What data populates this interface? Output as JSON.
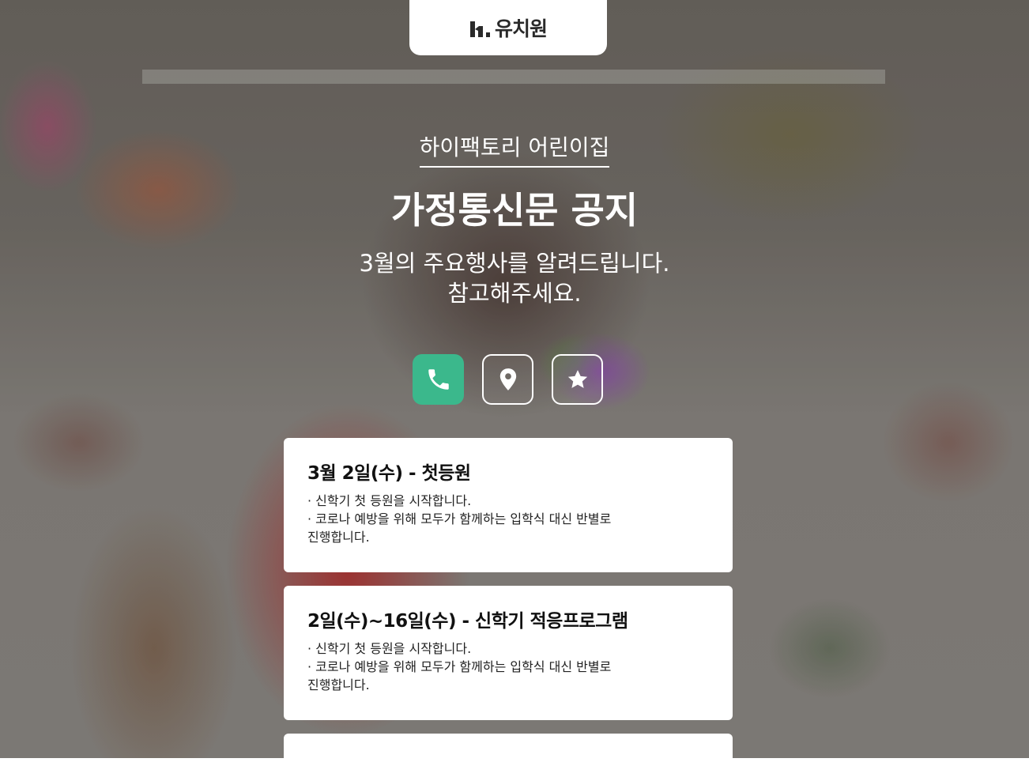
{
  "header": {
    "logo_text": "유치원",
    "logo_mark": "H."
  },
  "hero": {
    "org_name": "하이팩토리 어린이집",
    "title": "가정통신문 공지",
    "subtitle_line1": "3월의 주요행사를 알려드립니다.",
    "subtitle_line2": "참고해주세요."
  },
  "actions": [
    {
      "icon": "phone-icon",
      "color": "#3bb88c"
    },
    {
      "icon": "location-pin-icon",
      "color": "#ffffff"
    },
    {
      "icon": "star-icon",
      "color": "#ffffff"
    }
  ],
  "events": [
    {
      "title": "3월 2일(수) - 첫등원",
      "lines": [
        "· 신학기 첫 등원을 시작합니다.",
        "· 코로나 예방을 위해 모두가 함께하는 입학식 대신 반별로",
        "진행합니다."
      ]
    },
    {
      "title": "2일(수)~16일(수) - 신학기 적응프로그램",
      "lines": [
        "· 신학기 첫 등원을 시작합니다.",
        "· 코로나 예방을 위해 모두가 함께하는 입학식 대신 반별로",
        "진행합니다."
      ]
    }
  ]
}
